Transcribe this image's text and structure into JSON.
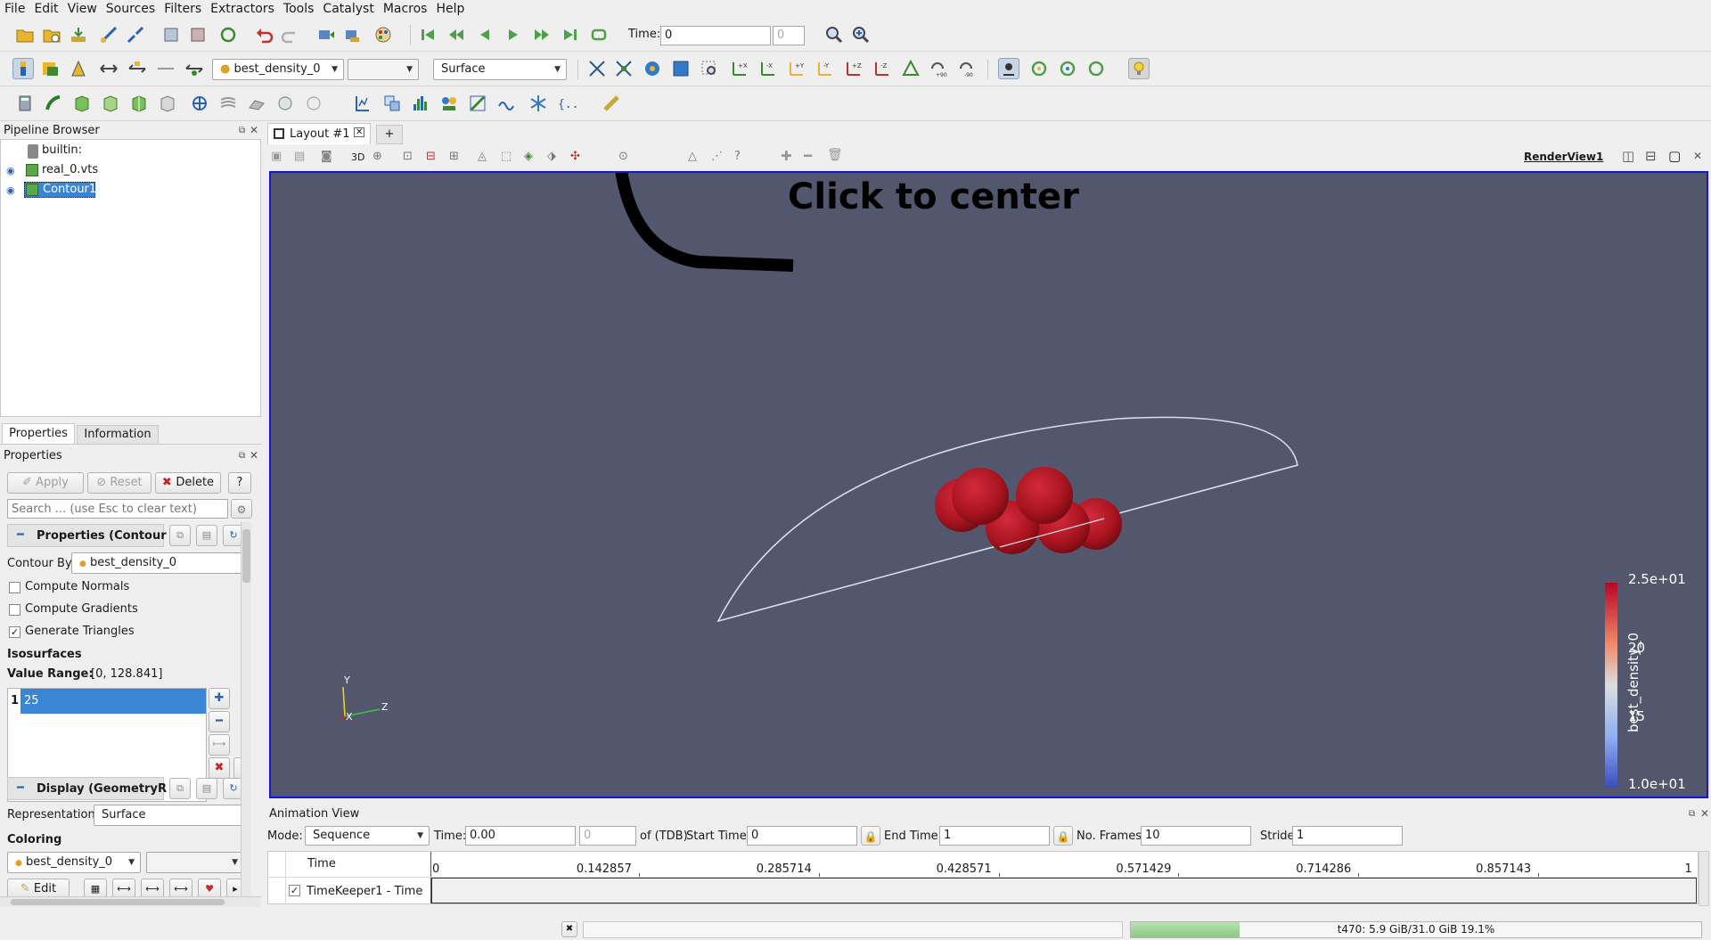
{
  "menu": [
    "File",
    "Edit",
    "View",
    "Sources",
    "Filters",
    "Extractors",
    "Tools",
    "Catalyst",
    "Macros",
    "Help"
  ],
  "toolbar1": {
    "time_label": "Time:",
    "time_value": "0",
    "time_index": "0"
  },
  "toolbar2": {
    "array_select": "best_density_0",
    "component_select": "",
    "representation_select": "Surface"
  },
  "pipeline": {
    "title": "Pipeline Browser",
    "items": [
      {
        "label": "builtin:"
      },
      {
        "label": "real_0.vts"
      },
      {
        "label": "Contour1"
      }
    ]
  },
  "tabs": {
    "layout_tab": "Layout #1",
    "add_tab": "+",
    "properties_tab": "Properties",
    "information_tab": "Information"
  },
  "properties": {
    "title": "Properties",
    "apply_label": "Apply",
    "reset_label": "Reset",
    "delete_label": "Delete",
    "help_label": "?",
    "search_placeholder": "Search ... (use Esc to clear text)",
    "section_contour": "Properties (Contour",
    "contour_by_label": "Contour By",
    "contour_by_value": "best_density_0",
    "compute_normals": "Compute Normals",
    "compute_gradients": "Compute Gradients",
    "generate_triangles": "Generate Triangles",
    "isosurfaces_label": "Isosurfaces",
    "value_range_label": "Value Range:",
    "value_range": "[0, 128.841]",
    "iso_index": "1",
    "iso_value": "25",
    "section_display": "Display (GeometryR",
    "representation_label": "Representation",
    "representation_value": "Surface",
    "coloring_label": "Coloring",
    "coloring_value": "best_density_0",
    "edit_label": "Edit"
  },
  "view": {
    "render_view_label": "RenderView1",
    "annotation": "Click to center",
    "colorbar": {
      "title": "best_density_0",
      "max": "2.5e+01",
      "t20": "20",
      "t15": "15",
      "min": "1.0e+01"
    },
    "axes": {
      "y": "Y",
      "x": "X",
      "z": "Z"
    }
  },
  "animation": {
    "title": "Animation View",
    "mode_label": "Mode:",
    "mode_value": "Sequence",
    "time_label": "Time:",
    "time_value": "0.00",
    "time_index": "0",
    "of_label": "of (TDB)",
    "start_label": "Start Time:",
    "start_value": "0",
    "end_label": "End Time:",
    "end_value": "1",
    "frames_label": "No. Frames:",
    "frames_value": "10",
    "stride_label": "Stride",
    "stride_value": "1",
    "time_col": "Time",
    "ticks": [
      "0",
      "0.142857",
      "0.285714",
      "0.428571",
      "0.571429",
      "0.714286",
      "0.857143",
      "1"
    ],
    "track": "TimeKeeper1 - Time"
  },
  "status": {
    "memory": "t470: 5.9 GiB/31.0 GiB 19.1%",
    "memory_fraction": 0.191
  },
  "colors": {
    "background": "#52576e",
    "accent": "#1515e0",
    "selection": "#3a86d4",
    "blob": "#b5192a"
  }
}
